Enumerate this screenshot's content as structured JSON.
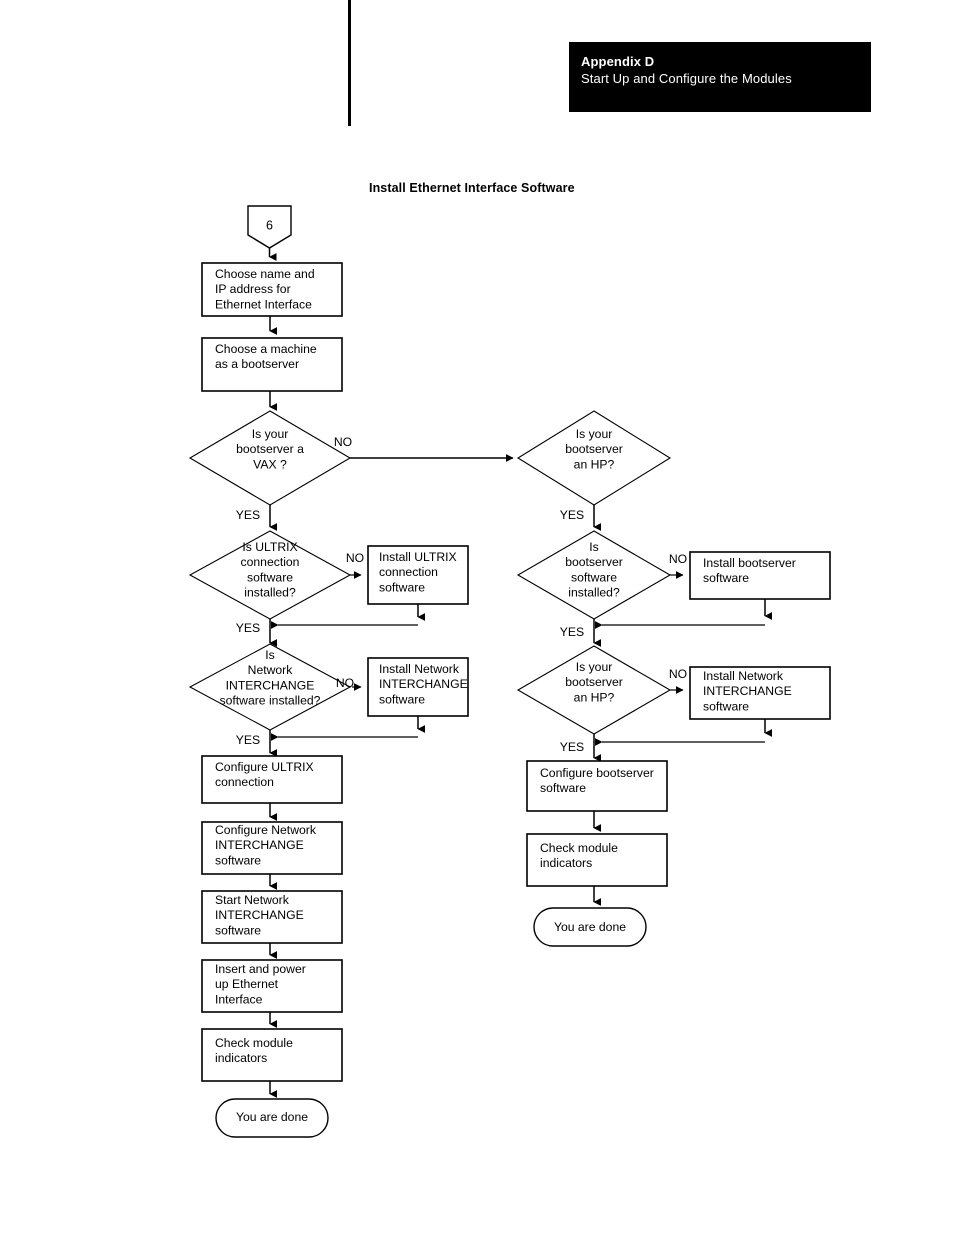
{
  "header": {
    "appendix": "Appendix D",
    "subtitle": "Start Up and Configure the Modules"
  },
  "figure": {
    "title": "Install Ethernet Interface Software"
  },
  "labels": {
    "yes": "YES",
    "no": "NO"
  },
  "connector": {
    "page_ref": "6"
  },
  "left_branch": {
    "n_choose_name": "Choose name and\nIP address for\nEthernet Interface",
    "n_choose_machine": "Choose a machine\nas a bootserver",
    "d_vax": "Is your\nbootserver a\nVAX ?",
    "d_ultrix": "Is ULTRIX\nconnection\nsoftware\ninstalled?",
    "b_install_ultrix": "Install ULTRIX\nconnection\nsoftware",
    "d_interchange": "Is\nNetwork\nINTERCHANGE\nsoftware installed?",
    "b_install_interchange": "Install Network\nINTERCHANGE\nsoftware",
    "n_config_ultrix": "Configure ULTRIX\nconnection",
    "n_config_interchange": "Configure Network\nINTERCHANGE\nsoftware",
    "n_start_interchange": "Start Network\nINTERCHANGE\nsoftware",
    "n_insert_power": "Insert and power\nup Ethernet\nInterface",
    "n_check_module": "Check module\nindicators",
    "t_done": "You are done"
  },
  "right_branch": {
    "d_hp1": "Is your\nbootserver\nan HP?",
    "d_bootserver_sw": "Is\nbootserver\nsoftware\ninstalled?",
    "b_install_bootserver": "Install bootserver\nsoftware",
    "d_hp2": "Is your\nbootserver\nan HP?",
    "b_install_interchange": "Install Network\nINTERCHANGE\nsoftware",
    "n_config_bootserver": "Configure bootserver\nsoftware",
    "n_check_module": "Check module\nindicators",
    "t_done": "You are done"
  },
  "colors": {
    "ink": "#000000",
    "paper": "#ffffff",
    "banner_bg": "#000000",
    "banner_fg": "#ffffff"
  }
}
